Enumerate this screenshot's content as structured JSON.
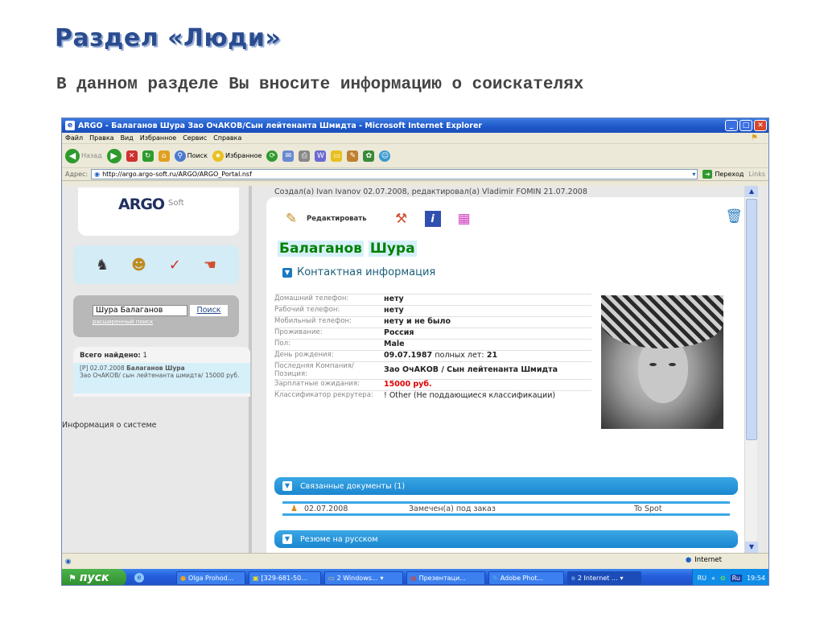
{
  "slide": {
    "title": "Раздел «Люди»",
    "subtitle": "В данном разделе Вы вносите информацию о соискателях"
  },
  "window": {
    "title": "ARGO - Балаганов Шура Зао ОчАКОВ/Сын лейтенанта Шмидта - Microsoft Internet Explorer",
    "menu": [
      "Файл",
      "Правка",
      "Вид",
      "Избранное",
      "Сервис",
      "Справка"
    ],
    "toolbar": {
      "back": "Назад",
      "search": "Поиск",
      "favorites": "Избранное"
    },
    "address": {
      "label": "Адрес:",
      "url": "http://argo.argo-soft.ru/ARGO/ARGO_Portal.nsf",
      "go": "Переход",
      "links": "Links"
    }
  },
  "sidebar": {
    "logo_main": "ARGO",
    "logo_sub": "Soft",
    "search_value": "Шура Балаганов",
    "search_button": "Поиск",
    "advanced_search": "расширенный поиск",
    "results_label": "Всего найдено:",
    "results_count": "1",
    "result_prefix": "[P] 02.07.2008",
    "result_name": "Балаганов Шура",
    "result_detail": "Зао ОчАКОВ/ сын лейтенанта шмидта/ 15000 руб.",
    "system_info": "Информация о системе"
  },
  "record": {
    "created_line": "Создал(а) Ivan Ivanov 02.07.2008, редактировал(а) Vladimir FOMIN 21.07.2008",
    "edit_label": "Редактировать",
    "last_name": "Балаганов",
    "first_name": "Шура",
    "contact_section": "Контактная информация",
    "fields": [
      {
        "label": "Домашний телефон:",
        "value": "нету"
      },
      {
        "label": "Рабочий телефон:",
        "value": "нету"
      },
      {
        "label": "Мобильный телефон:",
        "value": "нету и не было"
      },
      {
        "label": "Проживание:",
        "value": "Россия"
      },
      {
        "label": "Пол:",
        "value": "Male"
      },
      {
        "label": "День рождения:",
        "value": "09.07.1987",
        "extra": "полных лет:",
        "age": "21"
      },
      {
        "label": "Последняя Компания/Позиция:",
        "value": "Зао ОчАКОВ / Сын лейтенанта Шмидта"
      },
      {
        "label": "Зарплатные ожидания:",
        "value": "15000 руб."
      },
      {
        "label": "Классификатор рекрутера:",
        "value": "! Other (Не поддающиеся классификации)"
      }
    ],
    "related_docs": "Связанные документы (1)",
    "doc_date": "02.07.2008",
    "doc_status": "Замечен(а) под заказ",
    "doc_target": "To Spot",
    "resume_section": "Резюме на русском"
  },
  "status": {
    "zone": "Internet"
  },
  "taskbar": {
    "start": "пуск",
    "items": [
      "Olga Prohod...",
      "[329-681-50...",
      "2 Windows...",
      "Презентаци...",
      "Adobe Phot...",
      "2 Internet ..."
    ],
    "lang": "RU",
    "clock": "19:54"
  }
}
